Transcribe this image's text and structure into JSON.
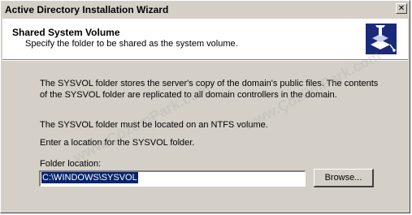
{
  "window": {
    "title": "Active Directory Installation Wizard",
    "close_glyph": "✕"
  },
  "header": {
    "title": "Shared System Volume",
    "subtitle": "Specify the folder to be shared as the system volume.",
    "icon": "wizard-network-icon"
  },
  "body": {
    "paragraph1": "The SYSVOL folder stores the server's copy of the domain's public files. The contents of the SYSVOL folder are replicated to all domain controllers in the domain.",
    "paragraph2": "The SYSVOL folder must be located on an NTFS volume.",
    "paragraph3": "Enter a location for the SYSVOL folder.",
    "folder_label": "Folder location:",
    "folder_value": "C:\\WINDOWS\\SYSVOL",
    "browse_label": "Browse..."
  },
  "watermark": "www.ÇözümPark.com",
  "colors": {
    "dialog_bg": "#d4d0c8",
    "selection": "#0a246a"
  }
}
